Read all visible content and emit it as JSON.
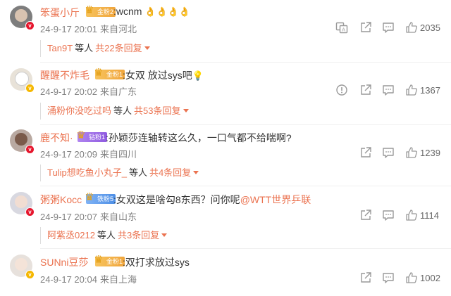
{
  "comments": [
    {
      "user": "笨蛋小斤",
      "fan_badge": "金粉2",
      "fan_color": "gold",
      "text": ":wcnm",
      "emoji": "👌👌👌👌",
      "date": "24-9-17 20:01",
      "location": "来自河北",
      "likes": "2035",
      "reply_names": "Tan9T",
      "reply_word": "等人",
      "reply_count": "共22条回复",
      "vbadge": "red"
    },
    {
      "user": "醒醒不炸毛",
      "fan_badge": "金粉1",
      "fan_color": "gold",
      "text": ":女双 放过sys吧",
      "emoji": "💡",
      "date": "24-9-17 20:02",
      "location": "来自广东",
      "likes": "1367",
      "reply_names": "涌粉你没吃过吗",
      "reply_word": "等人",
      "reply_count": "共53条回复",
      "vbadge": "gold"
    },
    {
      "user": "鹿不知·",
      "fan_badge": "钻粉1",
      "fan_color": "purple",
      "text": ":孙颖莎连轴转这么久，一口气都不给喘啊?",
      "date": "24-9-17 20:09",
      "location": "来自四川",
      "likes": "1239",
      "reply_names": "Tulip想吃鱼小丸子_",
      "reply_word": "等人",
      "reply_count": "共4条回复",
      "vbadge": "red"
    },
    {
      "user": "粥粥Kocc",
      "fan_badge": "铁粉5",
      "fan_color": "blue",
      "text": ":女双这是啥勾8东西？问你呢",
      "mention": "@WTT世界乒联",
      "date": "24-9-17 20:07",
      "location": "来自山东",
      "likes": "1114",
      "reply_names": "阿紫丞0212",
      "reply_word": "等人",
      "reply_count": "共3条回复",
      "vbadge": "red"
    },
    {
      "user": "SUNni豆莎",
      "fan_badge": "金粉1",
      "fan_color": "gold",
      "text": ":双打求放过sys",
      "date": "24-9-17 20:04",
      "location": "来自上海",
      "likes": "1002",
      "vbadge": "gold"
    }
  ],
  "icons": {
    "translate": "translate-icon",
    "report": "report-icon",
    "share": "share-icon",
    "comment": "comment-icon",
    "like": "thumbs-up-icon"
  },
  "colors": {
    "username": "#eb7350",
    "meta": "#808080",
    "verified_red": "#e6162d",
    "verified_gold": "#f5b700"
  }
}
